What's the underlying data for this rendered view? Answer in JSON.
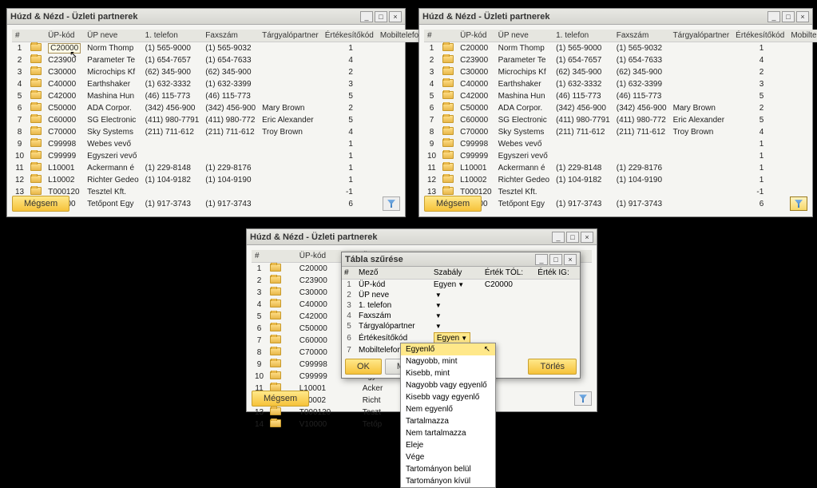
{
  "window_title": "Húzd & Nézd - Üzleti partnerek",
  "columns": [
    "#",
    "",
    "ÜP-kód",
    "ÜP neve",
    "1. telefon",
    "Faxszám",
    "Tárgyalópartner",
    "Értékesítőkód",
    "Mobiltelefon"
  ],
  "rows": [
    {
      "n": 1,
      "code": "C20000",
      "name": "Norm Thomp",
      "tel": "(1) 565-9000",
      "fax": "(1) 565-9032",
      "partner": "",
      "sales": "1",
      "mobile": ""
    },
    {
      "n": 2,
      "code": "C23900",
      "name": "Parameter Te",
      "tel": "(1) 654-7657",
      "fax": "(1) 654-7633",
      "partner": "",
      "sales": "4",
      "mobile": ""
    },
    {
      "n": 3,
      "code": "C30000",
      "name": "Microchips Kf",
      "tel": "(62) 345-900",
      "fax": "(62) 345-900",
      "partner": "",
      "sales": "2",
      "mobile": ""
    },
    {
      "n": 4,
      "code": "C40000",
      "name": "Earthshaker",
      "tel": "(1) 632-3332",
      "fax": "(1) 632-3399",
      "partner": "",
      "sales": "3",
      "mobile": ""
    },
    {
      "n": 5,
      "code": "C42000",
      "name": "Mashina Hun",
      "tel": "(46) 115-773",
      "fax": "(46) 115-773",
      "partner": "",
      "sales": "5",
      "mobile": ""
    },
    {
      "n": 6,
      "code": "C50000",
      "name": "ADA Corpor.",
      "tel": "(342) 456-900",
      "fax": "(342) 456-900",
      "partner": "Mary Brown",
      "sales": "2",
      "mobile": ""
    },
    {
      "n": 7,
      "code": "C60000",
      "name": "SG Electronic",
      "tel": "(411) 980-7791",
      "fax": "(411) 980-772",
      "partner": "Eric Alexander",
      "sales": "5",
      "mobile": ""
    },
    {
      "n": 8,
      "code": "C70000",
      "name": "Sky Systems",
      "tel": "(211) 711-612",
      "fax": "(211) 711-612",
      "partner": "Troy Brown",
      "sales": "4",
      "mobile": ""
    },
    {
      "n": 9,
      "code": "C99998",
      "name": "Webes vevő",
      "tel": "",
      "fax": "",
      "partner": "",
      "sales": "1",
      "mobile": ""
    },
    {
      "n": 10,
      "code": "C99999",
      "name": "Egyszeri vevő",
      "tel": "",
      "fax": "",
      "partner": "",
      "sales": "1",
      "mobile": ""
    },
    {
      "n": 11,
      "code": "L10001",
      "name": "Ackermann é",
      "tel": "(1) 229-8148",
      "fax": "(1) 229-8176",
      "partner": "",
      "sales": "1",
      "mobile": ""
    },
    {
      "n": 12,
      "code": "L10002",
      "name": "Richter Gedeo",
      "tel": "(1) 104-9182",
      "fax": "(1) 104-9190",
      "partner": "",
      "sales": "1",
      "mobile": ""
    },
    {
      "n": 13,
      "code": "T000120",
      "name": "Tesztel Kft.",
      "tel": "",
      "fax": "",
      "partner": "",
      "sales": "-1",
      "mobile": ""
    },
    {
      "n": 14,
      "code": "V10000",
      "name": "Tetőpont Egy",
      "tel": "(1) 917-3743",
      "fax": "(1) 917-3743",
      "partner": "",
      "sales": "6",
      "mobile": ""
    }
  ],
  "btn_cancel": "Mégsem",
  "filter_dialog": {
    "title": "Tábla szűrése",
    "cols": [
      "#",
      "Mező",
      "Szabály",
      "Érték TÓL:",
      "Érték IG:"
    ],
    "fields": [
      {
        "n": 1,
        "name": "ÜP-kód",
        "rule": "Egyen",
        "val": "C20000"
      },
      {
        "n": 2,
        "name": "ÜP neve",
        "rule": "",
        "val": ""
      },
      {
        "n": 3,
        "name": "1. telefon",
        "rule": "",
        "val": ""
      },
      {
        "n": 4,
        "name": "Faxszám",
        "rule": "",
        "val": ""
      },
      {
        "n": 5,
        "name": "Tárgyalópartner",
        "rule": "",
        "val": ""
      },
      {
        "n": 6,
        "name": "Értékesítőkód",
        "rule": "Egyen",
        "val": ""
      },
      {
        "n": 7,
        "name": "Mobiltelefon",
        "rule": "",
        "val": ""
      }
    ],
    "btn_ok": "OK",
    "btn_cancel": "Mégsem",
    "btn_clear": "Törlés"
  },
  "dropdown_items": [
    "Egyenlő",
    "Nagyobb, mint",
    "Kisebb, mint",
    "Nagyobb vagy egyenlő",
    "Kisebb vagy egyenlő",
    "Nem egyenlő",
    "Tartalmazza",
    "Nem tartalmazza",
    "Eleje",
    "Vége",
    "Tartományon belül",
    "Tartományon kívül"
  ]
}
